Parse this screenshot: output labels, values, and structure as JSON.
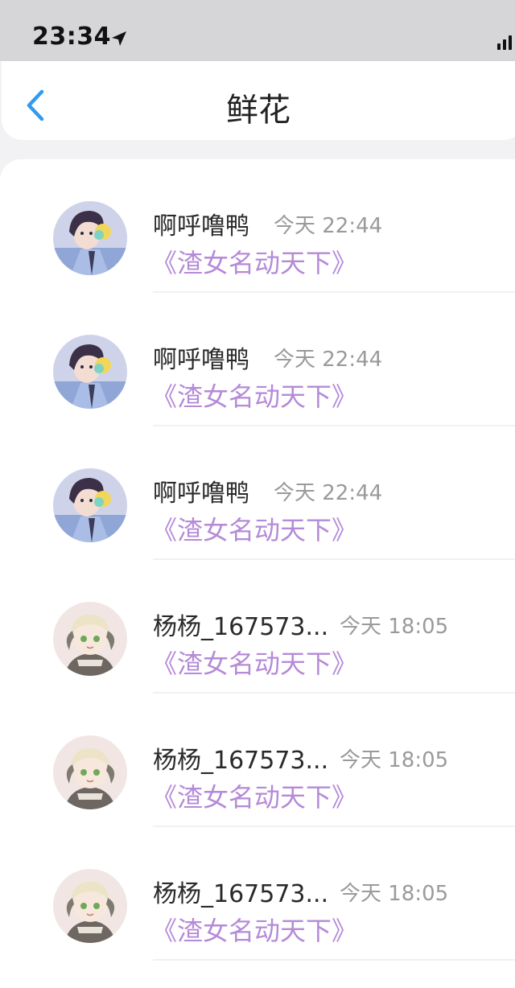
{
  "status_bar": {
    "time": "23:34"
  },
  "nav": {
    "title": "鲜花",
    "back_icon": "chevron-left-icon"
  },
  "colors": {
    "accent": "#2f9bf0",
    "gift_text": "#b58ad8",
    "time_text": "#9a9a9a"
  },
  "items": [
    {
      "name": "啊呼噜鸭",
      "time": "今天 22:44",
      "gift": "《渣女名动天下》",
      "avatar": "boy-avatar"
    },
    {
      "name": "啊呼噜鸭",
      "time": "今天 22:44",
      "gift": "《渣女名动天下》",
      "avatar": "boy-avatar"
    },
    {
      "name": "啊呼噜鸭",
      "time": "今天 22:44",
      "gift": "《渣女名动天下》",
      "avatar": "boy-avatar"
    },
    {
      "name": "杨杨_167573...",
      "time": "今天 18:05",
      "gift": "《渣女名动天下》",
      "avatar": "cat-boy-avatar"
    },
    {
      "name": "杨杨_167573...",
      "time": "今天 18:05",
      "gift": "《渣女名动天下》",
      "avatar": "cat-boy-avatar"
    },
    {
      "name": "杨杨_167573...",
      "time": "今天 18:05",
      "gift": "《渣女名动天下》",
      "avatar": "cat-boy-avatar"
    }
  ]
}
